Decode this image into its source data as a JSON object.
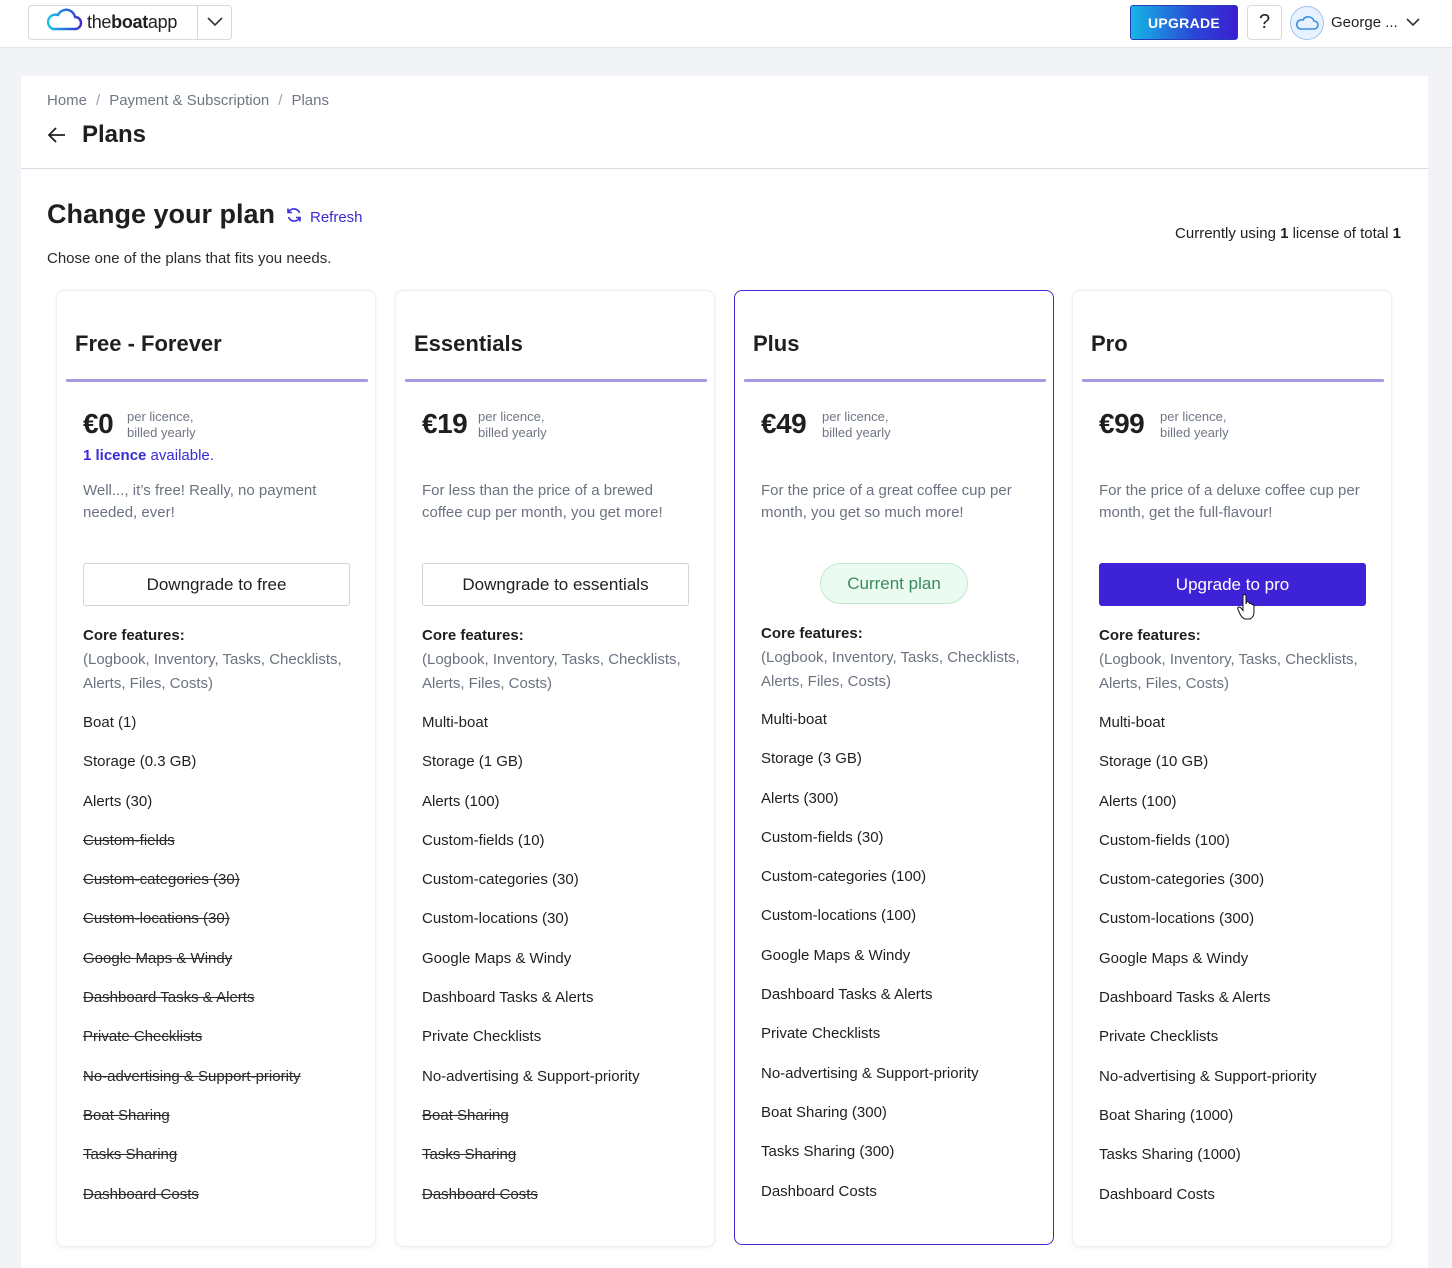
{
  "topbar": {
    "logo_prefix": "the",
    "logo_bold": "boat",
    "logo_suffix": "app",
    "upgrade_label": "UPGRADE",
    "help_label": "?",
    "user_name": "George ..."
  },
  "breadcrumb": [
    "Home",
    "Payment & Subscription",
    "Plans"
  ],
  "page_title": "Plans",
  "main": {
    "title": "Change your plan",
    "refresh_label": "Refresh",
    "subtitle": "Chose one of the plans that fits you needs.",
    "usage_prefix": "Currently using ",
    "usage_used": "1",
    "usage_mid": " license of total ",
    "usage_total": "1"
  },
  "colors": {
    "accent": "#3d22d8",
    "plan_rule": "#a79ae0",
    "current_pill_bg": "#ecfbf2",
    "current_pill_text": "#3a8a5e"
  },
  "plans": [
    {
      "name": "Free - Forever",
      "price": "€0",
      "price_note_1": "per licence,",
      "price_note_2": "billed yearly",
      "licence_bold": "1 licence",
      "licence_rest": " available.",
      "description": "Well..., it’s free! Really, no payment needed, ever!",
      "action": "Downgrade to free",
      "core_title": "Core features:",
      "core_list": "(Logbook, Inventory, Tasks, Checklists, Alerts, Files, Costs)",
      "features": [
        {
          "label": "Boat (1)",
          "enabled": true
        },
        {
          "label": "Storage (0.3 GB)",
          "enabled": true
        },
        {
          "label": "Alerts (30)",
          "enabled": true
        },
        {
          "label": "Custom-fields",
          "enabled": false
        },
        {
          "label": "Custom-categories (30)",
          "enabled": false
        },
        {
          "label": "Custom-locations (30)",
          "enabled": false
        },
        {
          "label": "Google Maps & Windy",
          "enabled": false
        },
        {
          "label": "Dashboard Tasks & Alerts",
          "enabled": false
        },
        {
          "label": "Private Checklists",
          "enabled": false
        },
        {
          "label": "No-advertising & Support-priority",
          "enabled": false
        },
        {
          "label": "Boat Sharing",
          "enabled": false
        },
        {
          "label": "Tasks Sharing",
          "enabled": false
        },
        {
          "label": "Dashboard Costs",
          "enabled": false
        }
      ]
    },
    {
      "name": "Essentials",
      "price": "€19",
      "price_note_1": "per licence,",
      "price_note_2": "billed yearly",
      "description": "For less than the price of a brewed coffee cup per month, you get more!",
      "action": "Downgrade to essentials",
      "core_title": "Core features:",
      "core_list": "(Logbook, Inventory, Tasks, Checklists, Alerts, Files, Costs)",
      "features": [
        {
          "label": "Multi-boat",
          "enabled": true
        },
        {
          "label": "Storage (1 GB)",
          "enabled": true
        },
        {
          "label": "Alerts (100)",
          "enabled": true
        },
        {
          "label": "Custom-fields (10)",
          "enabled": true
        },
        {
          "label": "Custom-categories (30)",
          "enabled": true
        },
        {
          "label": "Custom-locations (30)",
          "enabled": true
        },
        {
          "label": "Google Maps & Windy",
          "enabled": true
        },
        {
          "label": "Dashboard Tasks & Alerts",
          "enabled": true
        },
        {
          "label": "Private Checklists",
          "enabled": true
        },
        {
          "label": "No-advertising & Support-priority",
          "enabled": true
        },
        {
          "label": "Boat Sharing",
          "enabled": false
        },
        {
          "label": "Tasks Sharing",
          "enabled": false
        },
        {
          "label": "Dashboard Costs",
          "enabled": false
        }
      ]
    },
    {
      "name": "Plus",
      "price": "€49",
      "price_note_1": "per licence,",
      "price_note_2": "billed yearly",
      "description": "For the price of a great coffee cup per month, you get so much more!",
      "action": "Current plan",
      "core_title": "Core features:",
      "core_list": "(Logbook, Inventory, Tasks, Checklists, Alerts, Files, Costs)",
      "features": [
        {
          "label": "Multi-boat",
          "enabled": true
        },
        {
          "label": "Storage (3 GB)",
          "enabled": true
        },
        {
          "label": "Alerts (300)",
          "enabled": true
        },
        {
          "label": "Custom-fields (30)",
          "enabled": true
        },
        {
          "label": "Custom-categories (100)",
          "enabled": true
        },
        {
          "label": "Custom-locations (100)",
          "enabled": true
        },
        {
          "label": "Google Maps & Windy",
          "enabled": true
        },
        {
          "label": "Dashboard Tasks & Alerts",
          "enabled": true
        },
        {
          "label": "Private Checklists",
          "enabled": true
        },
        {
          "label": "No-advertising & Support-priority",
          "enabled": true
        },
        {
          "label": "Boat Sharing (300)",
          "enabled": true
        },
        {
          "label": "Tasks Sharing (300)",
          "enabled": true
        },
        {
          "label": "Dashboard Costs",
          "enabled": true
        }
      ]
    },
    {
      "name": "Pro",
      "price": "€99",
      "price_note_1": "per licence,",
      "price_note_2": "billed yearly",
      "description": "For the price of a deluxe coffee cup per month, get the full-flavour!",
      "action": "Upgrade to pro",
      "core_title": "Core features:",
      "core_list": "(Logbook, Inventory, Tasks, Checklists, Alerts, Files, Costs)",
      "features": [
        {
          "label": "Multi-boat",
          "enabled": true
        },
        {
          "label": "Storage (10 GB)",
          "enabled": true
        },
        {
          "label": "Alerts (100)",
          "enabled": true
        },
        {
          "label": "Custom-fields (100)",
          "enabled": true
        },
        {
          "label": "Custom-categories (300)",
          "enabled": true
        },
        {
          "label": "Custom-locations (300)",
          "enabled": true
        },
        {
          "label": "Google Maps & Windy",
          "enabled": true
        },
        {
          "label": "Dashboard Tasks & Alerts",
          "enabled": true
        },
        {
          "label": "Private Checklists",
          "enabled": true
        },
        {
          "label": "No-advertising & Support-priority",
          "enabled": true
        },
        {
          "label": "Boat Sharing (1000)",
          "enabled": true
        },
        {
          "label": "Tasks Sharing (1000)",
          "enabled": true
        },
        {
          "label": "Dashboard Costs",
          "enabled": true
        }
      ]
    }
  ]
}
